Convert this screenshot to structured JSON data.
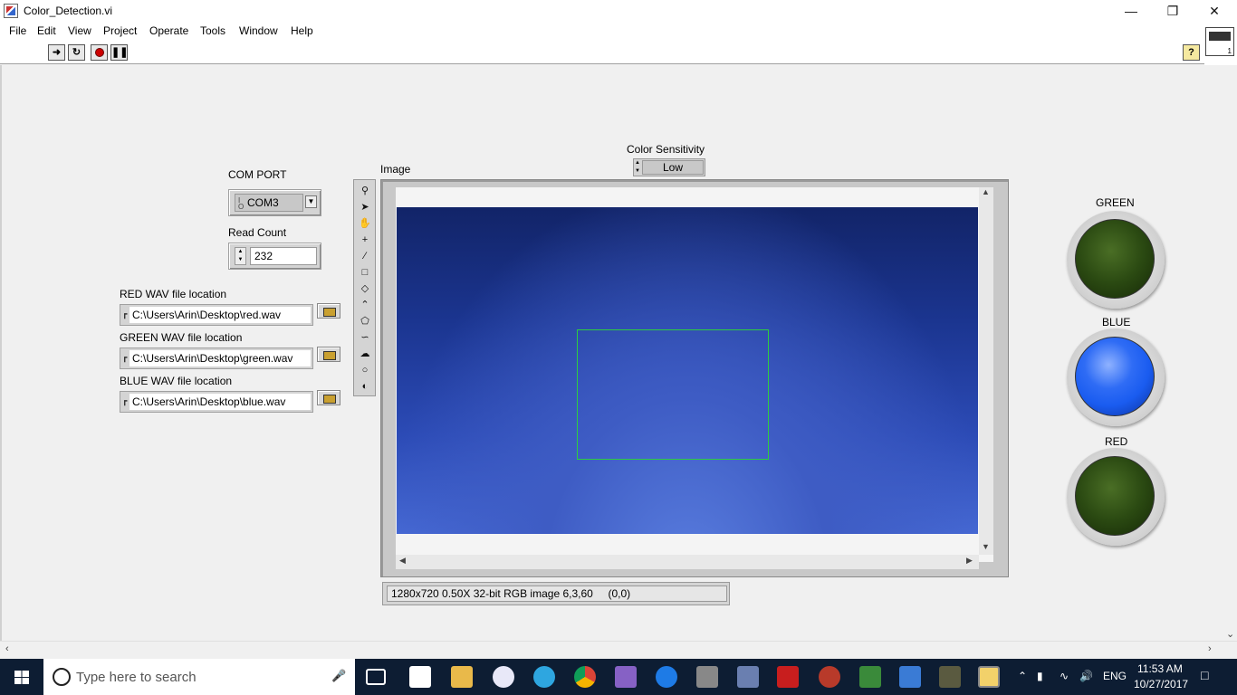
{
  "window": {
    "title": "Color_Detection.vi"
  },
  "menu": [
    "File",
    "Edit",
    "View",
    "Project",
    "Operate",
    "Tools",
    "Window",
    "Help"
  ],
  "toolbar": {
    "help": "?"
  },
  "controls": {
    "com_port": {
      "label": "COM PORT",
      "value": "COM3"
    },
    "read_count": {
      "label": "Read Count",
      "value": "232"
    },
    "red_wav": {
      "label": "RED WAV file location",
      "value": "C:\\Users\\Arin\\Desktop\\red.wav"
    },
    "green_wav": {
      "label": "GREEN WAV file location",
      "value": "C:\\Users\\Arin\\Desktop\\green.wav"
    },
    "blue_wav": {
      "label": "BLUE WAV file location",
      "value": "C:\\Users\\Arin\\Desktop\\blue.wav"
    },
    "color_sensitivity": {
      "label": "Color Sensitivity",
      "value": "Low"
    }
  },
  "image": {
    "label": "Image",
    "status": "1280x720 0.50X 32-bit RGB image 6,3,60     (0,0)"
  },
  "indicators": [
    {
      "label": "GREEN",
      "state": "off",
      "color": "#2b4a12"
    },
    {
      "label": "BLUE",
      "state": "on",
      "color": "#1a5cf0"
    },
    {
      "label": "RED",
      "state": "off",
      "color": "#2b4a12"
    }
  ],
  "taskbar": {
    "search_placeholder": "Type here to search",
    "language": "ENG",
    "time": "11:53 AM",
    "date": "10/27/2017"
  }
}
